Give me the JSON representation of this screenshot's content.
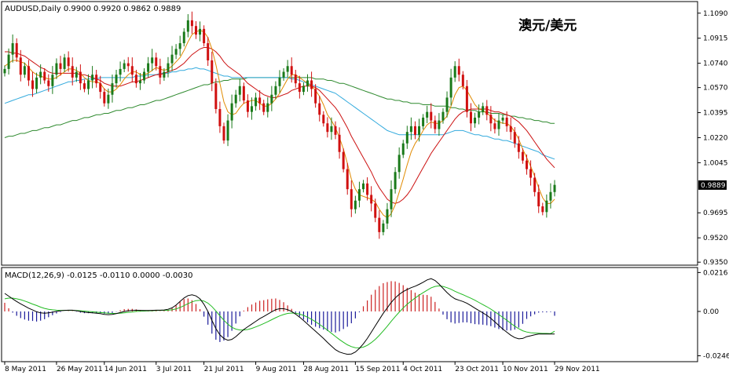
{
  "colors": {
    "bull": "#1a7a1a",
    "bear": "#d01010",
    "ma_fast": "#e08a00",
    "ma_mid": "#cc1111",
    "ma_slow1": "#33aadd",
    "ma_slow2": "#2f8a2f",
    "macd_line": "#000000",
    "signal_line": "#22bb22",
    "hist_pos": "#cc2222",
    "hist_neg": "#1a1a9a",
    "price_box": "#000000"
  },
  "chart_data": {
    "type": "candlestick",
    "symbol_header": "AUDUSD,Daily  0.9900 0.9920 0.9862 0.9889",
    "overlay_title": "澳元/美元",
    "last_price": "0.9889",
    "price_axis": {
      "ylim": [
        0.934,
        1.116
      ],
      "ticks": [
        "1.1090",
        "1.0915",
        "1.0740",
        "1.0570",
        "1.0395",
        "1.0220",
        "1.0045",
        "0.9695",
        "0.9520",
        "0.9350"
      ]
    },
    "date_labels": [
      "8 May 2011",
      "26 May 2011",
      "14 Jun 2011",
      "3 Jul 2011",
      "21 Jul 2011",
      "9 Aug 2011",
      "28 Aug 2011",
      "15 Sep 2011",
      "4 Oct 2011",
      "23 Oct 2011",
      "10 Nov 2011",
      "29 Nov 2011"
    ],
    "closes": [
      1.07,
      1.08,
      1.088,
      1.078,
      1.066,
      1.072,
      1.062,
      1.056,
      1.064,
      1.068,
      1.062,
      1.058,
      1.066,
      1.074,
      1.07,
      1.078,
      1.072,
      1.064,
      1.068,
      1.06,
      1.056,
      1.062,
      1.066,
      1.06,
      1.054,
      1.046,
      1.052,
      1.06,
      1.066,
      1.07,
      1.074,
      1.072,
      1.066,
      1.06,
      1.062,
      1.068,
      1.074,
      1.078,
      1.072,
      1.064,
      1.068,
      1.074,
      1.08,
      1.084,
      1.088,
      1.096,
      1.104,
      1.1,
      1.094,
      1.098,
      1.088,
      1.076,
      1.06,
      1.042,
      1.03,
      1.02,
      1.034,
      1.046,
      1.052,
      1.058,
      1.048,
      1.04,
      1.044,
      1.05,
      1.046,
      1.04,
      1.046,
      1.052,
      1.058,
      1.064,
      1.068,
      1.072,
      1.066,
      1.06,
      1.054,
      1.058,
      1.062,
      1.056,
      1.046,
      1.038,
      1.032,
      1.026,
      1.03,
      1.024,
      1.012,
      1.0,
      0.986,
      0.972,
      0.978,
      0.986,
      0.99,
      0.982,
      0.976,
      0.966,
      0.956,
      0.962,
      0.972,
      0.986,
      0.998,
      1.01,
      1.018,
      1.026,
      1.03,
      1.024,
      1.03,
      1.036,
      1.04,
      1.034,
      1.028,
      1.034,
      1.04,
      1.05,
      1.064,
      1.072,
      1.066,
      1.058,
      1.04,
      1.032,
      1.036,
      1.04,
      1.044,
      1.038,
      1.032,
      1.028,
      1.034,
      1.036,
      1.03,
      1.026,
      1.018,
      1.012,
      1.006,
      1.0,
      0.994,
      0.984,
      0.974,
      0.97,
      0.978,
      0.984,
      0.989
    ],
    "ma_fast": [
      1.072,
      1.074,
      1.076,
      1.076,
      1.075,
      1.074,
      1.071,
      1.068,
      1.066,
      1.065,
      1.064,
      1.063,
      1.063,
      1.064,
      1.066,
      1.068,
      1.07,
      1.07,
      1.069,
      1.067,
      1.064,
      1.062,
      1.061,
      1.061,
      1.06,
      1.056,
      1.054,
      1.054,
      1.056,
      1.059,
      1.063,
      1.066,
      1.068,
      1.068,
      1.066,
      1.066,
      1.067,
      1.069,
      1.071,
      1.07,
      1.069,
      1.07,
      1.072,
      1.075,
      1.078,
      1.083,
      1.089,
      1.094,
      1.096,
      1.097,
      1.096,
      1.092,
      1.084,
      1.073,
      1.06,
      1.047,
      1.04,
      1.038,
      1.039,
      1.043,
      1.046,
      1.047,
      1.048,
      1.048,
      1.046,
      1.044,
      1.044,
      1.046,
      1.049,
      1.053,
      1.058,
      1.063,
      1.066,
      1.066,
      1.064,
      1.062,
      1.06,
      1.058,
      1.055,
      1.051,
      1.045,
      1.038,
      1.034,
      1.029,
      1.022,
      1.014,
      1.004,
      0.993,
      0.986,
      0.982,
      0.981,
      0.98,
      0.979,
      0.977,
      0.972,
      0.968,
      0.966,
      0.969,
      0.975,
      0.984,
      0.993,
      1.003,
      1.012,
      1.018,
      1.022,
      1.027,
      1.031,
      1.033,
      1.032,
      1.032,
      1.034,
      1.037,
      1.044,
      1.052,
      1.057,
      1.058,
      1.055,
      1.05,
      1.045,
      1.042,
      1.041,
      1.039,
      1.037,
      1.034,
      1.033,
      1.032,
      1.032,
      1.03,
      1.026,
      1.021,
      1.014,
      1.008,
      1.002,
      0.995,
      0.987,
      0.98,
      0.976,
      0.976,
      0.979
    ],
    "ma_mid": [
      1.082,
      1.082,
      1.081,
      1.081,
      1.08,
      1.079,
      1.077,
      1.075,
      1.073,
      1.071,
      1.07,
      1.068,
      1.067,
      1.067,
      1.067,
      1.067,
      1.067,
      1.067,
      1.067,
      1.066,
      1.066,
      1.065,
      1.064,
      1.063,
      1.062,
      1.06,
      1.059,
      1.058,
      1.058,
      1.058,
      1.059,
      1.06,
      1.061,
      1.061,
      1.062,
      1.063,
      1.064,
      1.065,
      1.066,
      1.066,
      1.067,
      1.068,
      1.069,
      1.07,
      1.072,
      1.074,
      1.077,
      1.08,
      1.082,
      1.084,
      1.085,
      1.085,
      1.084,
      1.082,
      1.079,
      1.075,
      1.072,
      1.07,
      1.068,
      1.066,
      1.063,
      1.06,
      1.058,
      1.056,
      1.054,
      1.052,
      1.051,
      1.05,
      1.05,
      1.051,
      1.052,
      1.053,
      1.055,
      1.056,
      1.057,
      1.058,
      1.058,
      1.058,
      1.057,
      1.055,
      1.052,
      1.049,
      1.046,
      1.043,
      1.039,
      1.034,
      1.029,
      1.023,
      1.018,
      1.013,
      1.008,
      1.003,
      0.998,
      0.992,
      0.987,
      0.983,
      0.979,
      0.977,
      0.976,
      0.977,
      0.979,
      0.982,
      0.986,
      0.991,
      0.996,
      1.001,
      1.006,
      1.011,
      1.015,
      1.019,
      1.023,
      1.027,
      1.031,
      1.035,
      1.038,
      1.04,
      1.041,
      1.042,
      1.042,
      1.042,
      1.042,
      1.042,
      1.041,
      1.04,
      1.04,
      1.039,
      1.038,
      1.037,
      1.035,
      1.033,
      1.03,
      1.027,
      1.023,
      1.019,
      1.015,
      1.011,
      1.007,
      1.004,
      1.001
    ],
    "ma_slow1": [
      1.046,
      1.047,
      1.048,
      1.049,
      1.05,
      1.051,
      1.052,
      1.052,
      1.053,
      1.054,
      1.055,
      1.056,
      1.057,
      1.058,
      1.059,
      1.06,
      1.061,
      1.061,
      1.062,
      1.062,
      1.063,
      1.063,
      1.063,
      1.063,
      1.064,
      1.064,
      1.064,
      1.064,
      1.064,
      1.064,
      1.064,
      1.064,
      1.064,
      1.065,
      1.065,
      1.065,
      1.066,
      1.066,
      1.066,
      1.067,
      1.067,
      1.067,
      1.068,
      1.068,
      1.069,
      1.069,
      1.07,
      1.07,
      1.071,
      1.07,
      1.07,
      1.069,
      1.068,
      1.067,
      1.066,
      1.065,
      1.065,
      1.064,
      1.064,
      1.064,
      1.064,
      1.064,
      1.064,
      1.064,
      1.064,
      1.064,
      1.064,
      1.064,
      1.064,
      1.064,
      1.064,
      1.064,
      1.063,
      1.063,
      1.062,
      1.061,
      1.06,
      1.059,
      1.058,
      1.057,
      1.056,
      1.055,
      1.054,
      1.053,
      1.051,
      1.049,
      1.047,
      1.045,
      1.043,
      1.041,
      1.039,
      1.037,
      1.035,
      1.033,
      1.031,
      1.029,
      1.027,
      1.026,
      1.025,
      1.024,
      1.024,
      1.024,
      1.024,
      1.024,
      1.024,
      1.024,
      1.024,
      1.024,
      1.024,
      1.024,
      1.024,
      1.025,
      1.026,
      1.027,
      1.027,
      1.027,
      1.026,
      1.025,
      1.024,
      1.024,
      1.023,
      1.023,
      1.022,
      1.021,
      1.021,
      1.02,
      1.02,
      1.019,
      1.018,
      1.017,
      1.016,
      1.015,
      1.014,
      1.013,
      1.012,
      1.01,
      1.009,
      1.008,
      1.007
    ],
    "ma_slow2": [
      1.022,
      1.023,
      1.023,
      1.024,
      1.025,
      1.025,
      1.026,
      1.027,
      1.027,
      1.028,
      1.029,
      1.029,
      1.03,
      1.031,
      1.031,
      1.032,
      1.033,
      1.034,
      1.034,
      1.035,
      1.036,
      1.036,
      1.037,
      1.038,
      1.038,
      1.039,
      1.039,
      1.04,
      1.041,
      1.041,
      1.042,
      1.043,
      1.043,
      1.044,
      1.045,
      1.045,
      1.046,
      1.047,
      1.048,
      1.048,
      1.049,
      1.05,
      1.051,
      1.052,
      1.053,
      1.054,
      1.055,
      1.056,
      1.057,
      1.058,
      1.059,
      1.059,
      1.06,
      1.061,
      1.061,
      1.062,
      1.062,
      1.063,
      1.063,
      1.063,
      1.063,
      1.064,
      1.064,
      1.064,
      1.064,
      1.064,
      1.064,
      1.064,
      1.064,
      1.064,
      1.064,
      1.064,
      1.064,
      1.064,
      1.064,
      1.064,
      1.064,
      1.064,
      1.063,
      1.063,
      1.063,
      1.062,
      1.062,
      1.061,
      1.06,
      1.06,
      1.059,
      1.058,
      1.057,
      1.056,
      1.055,
      1.054,
      1.053,
      1.052,
      1.051,
      1.05,
      1.049,
      1.049,
      1.048,
      1.048,
      1.047,
      1.047,
      1.046,
      1.046,
      1.046,
      1.045,
      1.045,
      1.045,
      1.044,
      1.044,
      1.044,
      1.044,
      1.043,
      1.043,
      1.042,
      1.042,
      1.041,
      1.041,
      1.041,
      1.04,
      1.04,
      1.04,
      1.039,
      1.039,
      1.039,
      1.038,
      1.038,
      1.037,
      1.037,
      1.036,
      1.036,
      1.035,
      1.035,
      1.034,
      1.034,
      1.033,
      1.033,
      1.032,
      1.032
    ],
    "macd": {
      "header": "MACD(12,26,9) -0.0125 -0.0110 0.0000 -0.0030",
      "ylim": [
        -0.027,
        0.0235
      ],
      "ticks": [
        "0.0216",
        "0.00",
        "-0.0246"
      ],
      "macd": [
        0.01,
        0.0085,
        0.007,
        0.0055,
        0.0042,
        0.003,
        0.0018,
        0.0008,
        -0.0002,
        -0.0008,
        -0.001,
        -0.0008,
        -0.0004,
        0.0,
        0.0004,
        0.0006,
        0.0007,
        0.0007,
        0.0004,
        0.0,
        -0.0004,
        -0.0006,
        -0.0008,
        -0.001,
        -0.0012,
        -0.0016,
        -0.0018,
        -0.0016,
        -0.0012,
        -0.0006,
        0.0,
        0.0004,
        0.0006,
        0.0007,
        0.0006,
        0.0005,
        0.0005,
        0.0006,
        0.0007,
        0.0007,
        0.0008,
        0.0012,
        0.002,
        0.0035,
        0.0055,
        0.0075,
        0.0088,
        0.0092,
        0.0086,
        0.007,
        0.004,
        0.0,
        -0.005,
        -0.0095,
        -0.013,
        -0.015,
        -0.016,
        -0.0155,
        -0.014,
        -0.012,
        -0.01,
        -0.0085,
        -0.007,
        -0.0055,
        -0.004,
        -0.0028,
        -0.0015,
        -0.0002,
        0.001,
        0.0015,
        0.0015,
        0.001,
        0.0,
        -0.0015,
        -0.0032,
        -0.005,
        -0.007,
        -0.009,
        -0.011,
        -0.013,
        -0.015,
        -0.0172,
        -0.0192,
        -0.0212,
        -0.0225,
        -0.0232,
        -0.0238,
        -0.0236,
        -0.0225,
        -0.0205,
        -0.018,
        -0.015,
        -0.0115,
        -0.008,
        -0.0045,
        -0.001,
        0.002,
        0.005,
        0.0075,
        0.0095,
        0.011,
        0.0122,
        0.0132,
        0.014,
        0.015,
        0.0162,
        0.0175,
        0.0182,
        0.0172,
        0.0152,
        0.0128,
        0.0105,
        0.0085,
        0.007,
        0.0062,
        0.0055,
        0.0045,
        0.0032,
        0.0018,
        0.0005,
        -0.0008,
        -0.0022,
        -0.0038,
        -0.0058,
        -0.0078,
        -0.0098,
        -0.0115,
        -0.0132,
        -0.0145,
        -0.0152,
        -0.015,
        -0.014,
        -0.0135,
        -0.013,
        -0.0125,
        -0.0125,
        -0.0125,
        -0.0125,
        -0.0125
      ],
      "signal": [
        0.007,
        0.0074,
        0.0074,
        0.007,
        0.0065,
        0.0058,
        0.005,
        0.0041,
        0.0033,
        0.0024,
        0.0017,
        0.0012,
        0.0009,
        0.0007,
        0.0006,
        0.0006,
        0.0006,
        0.0006,
        0.0005,
        0.0004,
        0.0002,
        0.0,
        -0.0002,
        -0.0004,
        -0.0006,
        -0.0008,
        -0.001,
        -0.0011,
        -0.0011,
        -0.001,
        -0.0008,
        -0.0005,
        -0.0003,
        0.0,
        0.0001,
        0.0002,
        0.0003,
        0.0004,
        0.0005,
        0.0006,
        0.0006,
        0.0007,
        0.0009,
        0.0014,
        0.0022,
        0.0032,
        0.0043,
        0.0053,
        0.006,
        0.0062,
        0.0058,
        0.0046,
        0.0027,
        0.0003,
        -0.0024,
        -0.0049,
        -0.0071,
        -0.0088,
        -0.0098,
        -0.0103,
        -0.0103,
        -0.01,
        -0.0094,
        -0.0086,
        -0.0077,
        -0.0067,
        -0.0057,
        -0.0046,
        -0.0035,
        -0.0025,
        -0.0017,
        -0.0011,
        -0.0009,
        -0.001,
        -0.0015,
        -0.0022,
        -0.0032,
        -0.0044,
        -0.0057,
        -0.0072,
        -0.0087,
        -0.0104,
        -0.0121,
        -0.0139,
        -0.0156,
        -0.0171,
        -0.0185,
        -0.0195,
        -0.0201,
        -0.0202,
        -0.0198,
        -0.0188,
        -0.0173,
        -0.0155,
        -0.0133,
        -0.0108,
        -0.0082,
        -0.0055,
        -0.0029,
        -0.0004,
        0.0019,
        0.004,
        0.0058,
        0.0075,
        0.009,
        0.0104,
        0.0118,
        0.0131,
        0.0139,
        0.0142,
        0.0139,
        0.0132,
        0.0123,
        0.0112,
        0.0102,
        0.0093,
        0.0083,
        0.0073,
        0.0062,
        0.005,
        0.0038,
        0.0026,
        0.0013,
        -0.0002,
        -0.0017,
        -0.0033,
        -0.0049,
        -0.0066,
        -0.0082,
        -0.0096,
        -0.0107,
        -0.0114,
        -0.0118,
        -0.012,
        -0.0121,
        -0.0122,
        -0.0122,
        -0.0123,
        -0.011
      ]
    }
  }
}
